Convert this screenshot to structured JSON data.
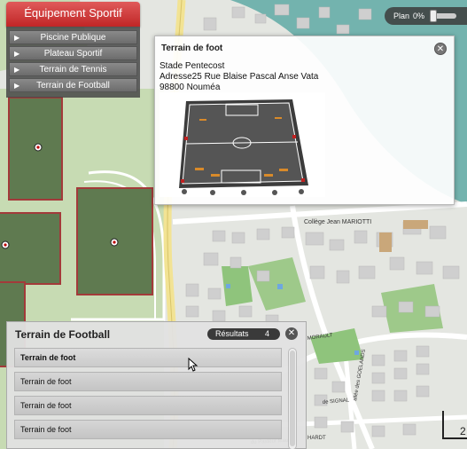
{
  "category_menu": {
    "title": "Équipement Sportif",
    "items": [
      {
        "label": "Piscine Publique"
      },
      {
        "label": "Plateau Sportif"
      },
      {
        "label": "Terrain de Tennis"
      },
      {
        "label": "Terrain de Football"
      }
    ]
  },
  "plan_control": {
    "label": "Plan",
    "value": "0%",
    "level": 0
  },
  "popup": {
    "title": "Terrain de foot",
    "close_icon": "close-icon",
    "lines": [
      "Stade Pentecost",
      "Adresse25 Rue Blaise Pascal Anse Vata",
      "98800 Nouméa"
    ]
  },
  "results_panel": {
    "title": "Terrain de Football",
    "count_label": "Résultats",
    "count": "4",
    "items": [
      "Terrain de foot",
      "Terrain de foot",
      "Terrain de foot",
      "Terrain de foot"
    ]
  },
  "map_labels": {
    "college": "Collège Jean MARIOTTI",
    "street_1": "MORAULT",
    "street_2": "allée des GOELANDS",
    "street_3": "de SIGNAL",
    "street_4": "du Pasteur Maurice",
    "street_5": "HARDT"
  },
  "scale_text": "2",
  "colors": {
    "accent_red": "#c02626",
    "field_green": "#5f7a50",
    "field_border": "#a33a3a"
  }
}
